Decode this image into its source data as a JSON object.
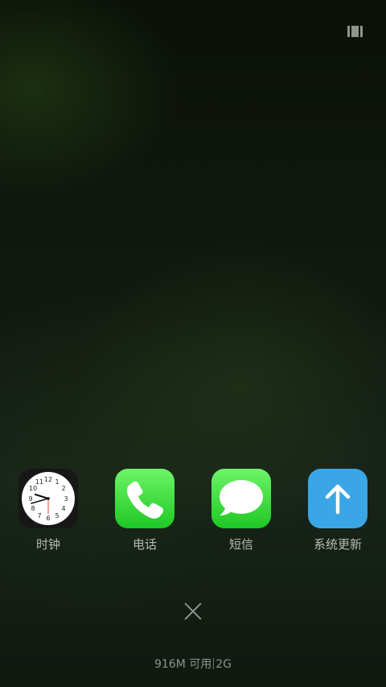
{
  "top_right": {
    "icon": "recents-view-icon"
  },
  "apps": [
    {
      "label": "时钟",
      "icon": "clock-icon"
    },
    {
      "label": "电话",
      "icon": "phone-icon"
    },
    {
      "label": "短信",
      "icon": "messages-icon"
    },
    {
      "label": "系统更新",
      "icon": "system-update-icon"
    }
  ],
  "clock_face": {
    "numbers": [
      "12",
      "1",
      "2",
      "3",
      "4",
      "5",
      "6",
      "7",
      "8",
      "9",
      "10",
      "11"
    ]
  },
  "close": {
    "icon": "close-icon"
  },
  "memory": {
    "available": "916M 可用",
    "network": "2G"
  },
  "colors": {
    "phone_green": "#1fc824",
    "update_blue": "#3aa6e6",
    "clock_second_hand": "#e8432e"
  }
}
